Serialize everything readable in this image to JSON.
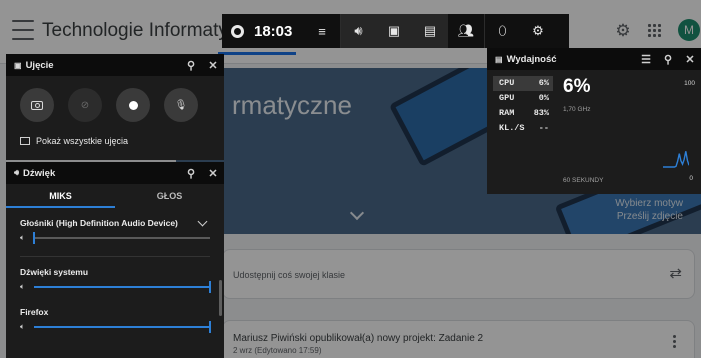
{
  "classroom": {
    "title": "Technologie Informatycz...",
    "avatar_letter": "M",
    "avatar_color": "#1e8e6e",
    "banner": {
      "title": "rmatyczne",
      "choose_theme": "Wybierz motyw",
      "upload_photo": "Prześlij zdjęcie"
    },
    "share_prompt": "Udostępnij coś swojej klasie",
    "post": {
      "title": "Mariusz Piwiński opublikował(a) nowy projekt: Zadanie 2",
      "date": "2 wrz (Edytowano 17:59)"
    }
  },
  "gamebar": {
    "time": "18:03",
    "icons": [
      "xbox-icon",
      "widget-menu-icon",
      "audio-icon",
      "capture-icon",
      "performance-icon",
      "social-icon",
      "mouse-icon",
      "settings-icon"
    ]
  },
  "capture_panel": {
    "title": "Ujęcie",
    "show_all": "Pokaż wszystkie ujęcia"
  },
  "audio_panel": {
    "title": "Dźwięk",
    "tabs": [
      "MIKS",
      "GŁOS"
    ],
    "active_tab": "MIKS",
    "device": "Głośniki (High Definition Audio Device)",
    "device_volume": 0.0,
    "apps": [
      {
        "name": "Dźwięki systemu",
        "volume": 1.0
      },
      {
        "name": "Firefox",
        "volume": 1.0
      }
    ]
  },
  "performance_panel": {
    "title": "Wydajność",
    "metrics": [
      {
        "label": "CPU",
        "value": "6%"
      },
      {
        "label": "GPU",
        "value": "0%"
      },
      {
        "label": "RAM",
        "value": "83%"
      },
      {
        "label": "KL./S",
        "value": "--"
      }
    ],
    "big_value": "6%",
    "frequency": "1,70 GHz",
    "max": "100",
    "min": "0",
    "window_label": "60 SEKUNDY",
    "accent_color": "#2d7fd6",
    "cpu_history": [
      0,
      0,
      0,
      0,
      0,
      0,
      0,
      0,
      2,
      20,
      48,
      22,
      10,
      26,
      56,
      24,
      6
    ]
  }
}
